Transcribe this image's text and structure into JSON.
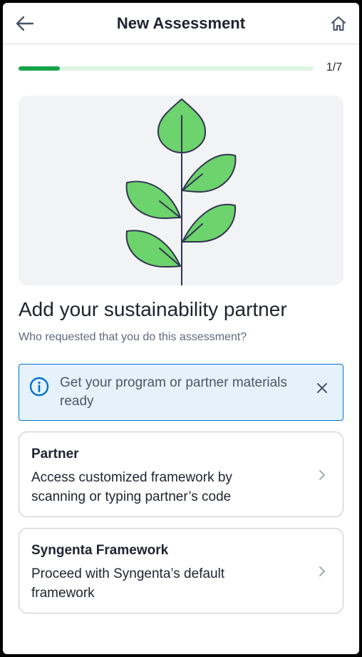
{
  "header": {
    "title": "New Assessment"
  },
  "progress": {
    "current": 1,
    "total": 7,
    "label": "1/7",
    "fraction": 0.14
  },
  "content": {
    "heading": "Add your sustainability partner",
    "subheading": "Who requested that you do this assessment?"
  },
  "banner": {
    "message": "Get your program or partner materials ready"
  },
  "options": [
    {
      "title": "Partner",
      "description": "Access customized framework by scanning or typing partner’s code"
    },
    {
      "title": "Syngenta Framework",
      "description": "Proceed with Syngenta’s default framework"
    }
  ],
  "colors": {
    "accent": "#0071cd",
    "progress": "#16a34a",
    "leaf": "#6dd36c",
    "stem": "#303451"
  },
  "icons": [
    "arrow-left-icon",
    "home-icon",
    "info-icon",
    "close-icon",
    "chevron-right-icon",
    "plant-illustration"
  ]
}
